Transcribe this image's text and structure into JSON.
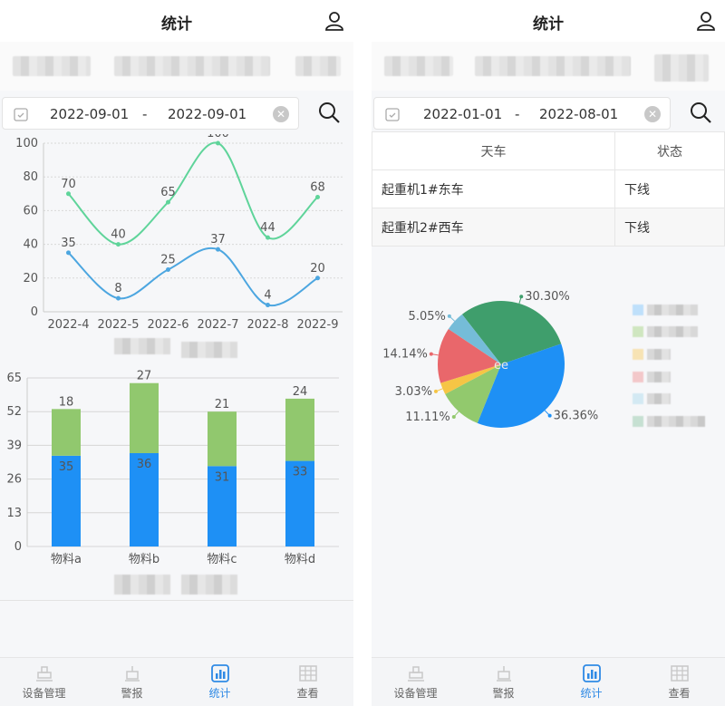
{
  "left": {
    "header": {
      "title": "统计"
    },
    "date": {
      "start": "2022-09-01",
      "sep": "-",
      "end": "2022-09-01"
    },
    "line_chart": {
      "type": "line",
      "x": [
        "2022-4",
        "2022-5",
        "2022-6",
        "2022-7",
        "2022-8",
        "2022-9"
      ],
      "ylim": [
        0,
        100
      ],
      "yticks": [
        "0",
        "20",
        "40",
        "60",
        "80",
        "100"
      ],
      "series": [
        {
          "values": [
            70,
            40,
            65,
            100,
            44,
            68
          ],
          "color": "#5fd49a"
        },
        {
          "values": [
            35,
            8,
            25,
            37,
            4,
            20
          ],
          "color": "#4ca6e0"
        }
      ]
    },
    "bar_chart": {
      "type": "bar",
      "categories": [
        "物料a",
        "物料b",
        "物料c",
        "物料d"
      ],
      "ylim": [
        0,
        65
      ],
      "yticks": [
        "0",
        "13",
        "26",
        "39",
        "52",
        "65"
      ],
      "series": [
        {
          "values": [
            35,
            36,
            31,
            33
          ],
          "color": "#1e90f5"
        },
        {
          "values": [
            18,
            27,
            21,
            24
          ],
          "color": "#91c86e"
        }
      ]
    }
  },
  "right": {
    "header": {
      "title": "统计"
    },
    "date": {
      "start": "2022-01-01",
      "sep": "-",
      "end": "2022-08-01"
    },
    "table": {
      "headers": [
        "天车",
        "状态"
      ],
      "rows": [
        [
          "起重机1#东车",
          "下线"
        ],
        [
          "起重机2#西车",
          "下线"
        ]
      ]
    },
    "pie_chart": {
      "type": "pie",
      "center_text": "ee",
      "slices": [
        {
          "label": "30.30%",
          "value": 30.3,
          "color": "#3f9e6c"
        },
        {
          "label": "36.36%",
          "value": 36.36,
          "color": "#1e90f5"
        },
        {
          "label": "11.11%",
          "value": 11.11,
          "color": "#92c96d"
        },
        {
          "label": "3.03%",
          "value": 3.03,
          "color": "#f6c545"
        },
        {
          "label": "14.14%",
          "value": 14.14,
          "color": "#e9676b"
        },
        {
          "label": "5.05%",
          "value": 5.05,
          "color": "#75bcd8"
        }
      ]
    }
  },
  "chart_data": [
    {
      "type": "line",
      "x": [
        "2022-4",
        "2022-5",
        "2022-6",
        "2022-7",
        "2022-8",
        "2022-9"
      ],
      "series": [
        {
          "values": [
            70,
            40,
            65,
            100,
            44,
            68
          ]
        },
        {
          "values": [
            35,
            8,
            25,
            37,
            4,
            20
          ]
        }
      ],
      "ylim": [
        0,
        100
      ]
    },
    {
      "type": "bar",
      "categories": [
        "物料a",
        "物料b",
        "物料c",
        "物料d"
      ],
      "series": [
        {
          "values": [
            35,
            36,
            31,
            33
          ]
        },
        {
          "values": [
            18,
            27,
            21,
            24
          ]
        }
      ],
      "stacked": true,
      "ylim": [
        0,
        65
      ]
    },
    {
      "type": "pie",
      "values": [
        30.3,
        36.36,
        11.11,
        3.03,
        14.14,
        5.05
      ],
      "labels": [
        "30.30%",
        "36.36%",
        "11.11%",
        "3.03%",
        "14.14%",
        "5.05%"
      ]
    }
  ],
  "tabs": [
    {
      "label": "设备管理",
      "icon": "equipment-icon"
    },
    {
      "label": "警报",
      "icon": "alarm-icon"
    },
    {
      "label": "统计",
      "icon": "stats-icon",
      "active": true
    },
    {
      "label": "查看",
      "icon": "grid-icon"
    }
  ]
}
